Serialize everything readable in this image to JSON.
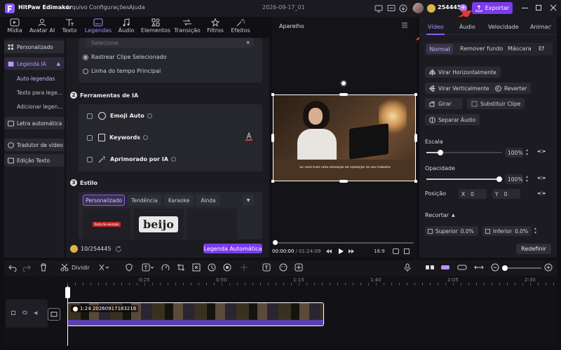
{
  "titlebar": {
    "app_name": "HitPaw Edimakor",
    "menus": [
      "Arquivo",
      "Configurações",
      "Ajuda"
    ],
    "project_name": "2026-09-17_01",
    "credits": "254445",
    "export_label": "Exportar"
  },
  "toolbar": {
    "tools": [
      {
        "label": "Mídia",
        "icon": "media-icon"
      },
      {
        "label": "Avatar AI",
        "icon": "avatar-icon"
      },
      {
        "label": "Texto",
        "icon": "text-icon"
      },
      {
        "label": "Legendas",
        "icon": "captions-icon",
        "active": true
      },
      {
        "label": "Áudio",
        "icon": "music-icon"
      },
      {
        "label": "Elementos",
        "icon": "elements-icon"
      },
      {
        "label": "Transição",
        "icon": "transition-icon"
      },
      {
        "label": "Filtros",
        "icon": "filter-icon"
      },
      {
        "label": "Efeitos",
        "icon": "effects-icon"
      }
    ]
  },
  "sidebar": {
    "personalizado": "Personalizado",
    "legenda_ia": "Legenda IA",
    "sub": [
      "Auto-legendas",
      "Texto para lege...",
      "Adicionar legen..."
    ],
    "letra": "Letra automática",
    "tradutor": "Tradutor de vídeo",
    "edicao": "Edição Texto"
  },
  "panel": {
    "select_placeholder": "Selecione",
    "radio1": "Rastrear Clipe Selecionado",
    "radio2": "Linha do tempo Principal",
    "section2_num": "2",
    "section2_title": "Ferramentas de IA",
    "ai_tools": [
      "Emoji Auto",
      "Keywords",
      "Aprimorado por IA"
    ],
    "section3_num": "3",
    "section3_title": "Estilo",
    "style_tabs": [
      "Personalizado",
      "Tendência",
      "Karaoke",
      "Ainda"
    ],
    "style_preview_text": "beijo",
    "style_small_text": "Texto de exemplo",
    "credits": "10/254445",
    "generate_label": "Legenda Automática"
  },
  "preview": {
    "title": "Aparelho",
    "subtitle": "Se você tiver uma sensação de repetição no seu trabalho",
    "time_current": "00:00:00",
    "time_total": "/ 01:24:09",
    "ratio": "16:9"
  },
  "right": {
    "tabs": [
      "Vídeo",
      "Áudio",
      "Velocidade",
      "Animaç"
    ],
    "subtabs": [
      "Normal",
      "Remover fundo",
      "Máscara",
      "Ef"
    ],
    "btn_flip_h": "Virar Horizontalmente",
    "btn_flip_v": "Virar Verticalmente",
    "btn_reverse": "Reverter",
    "btn_rotate": "Girar",
    "btn_replace": "Substituir Clipe",
    "btn_separate": "Separar Áudio",
    "scale_label": "Escala",
    "scale_value": "100%",
    "opacity_label": "Opacidade",
    "opacity_value": "100%",
    "position_label": "Posição",
    "pos_x_label": "X",
    "pos_x": "0",
    "pos_y_label": "Y",
    "pos_y": "0",
    "crop_label": "Recortar",
    "crop_top_label": "Superior",
    "crop_top": "0.0%",
    "crop_bottom_label": "Inferior",
    "crop_bottom": "0.0%",
    "reset_label": "Redefinir"
  },
  "tlbar": {
    "split_label": "Dividir"
  },
  "timeline": {
    "ticks": [
      "0:25",
      "0:50",
      "1:15",
      "1:40",
      "2:05",
      "2:30"
    ],
    "clip_label": "1:24  20260917183216"
  },
  "colors": {
    "accent": "#8b5cf6",
    "export": "#7c3aed",
    "red_arrow": "#e53935"
  }
}
